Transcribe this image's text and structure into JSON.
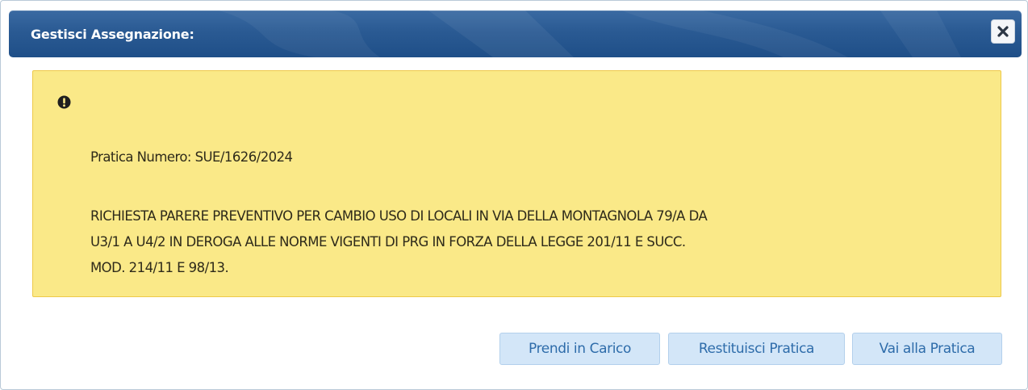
{
  "dialog": {
    "title": "Gestisci Assegnazione:",
    "close_icon": "close-icon"
  },
  "alert": {
    "icon": "exclamation-circle-icon",
    "practice_line": "Pratica Numero: SUE/1626/2024",
    "description_lines": [
      "RICHIESTA PARERE PREVENTIVO PER CAMBIO USO DI LOCALI IN VIA DELLA MONTAGNOLA 79/A DA",
      "U3/1 A U4/2 IN DEROGA ALLE NORME VIGENTI DI PRG IN FORZA DELLA LEGGE 201/11 E SUCC.",
      "MOD. 214/11 E 98/13."
    ],
    "background_color": "#fae988",
    "border_color": "#eec94a"
  },
  "buttons": {
    "take_charge": "Prendi in Carico",
    "return_practice": "Restituisci Pratica",
    "go_to_practice": "Vai alla Pratica"
  },
  "colors": {
    "titlebar": "#2a5a93",
    "button_bg": "#d3e6f8",
    "button_text": "#2e6caa"
  }
}
